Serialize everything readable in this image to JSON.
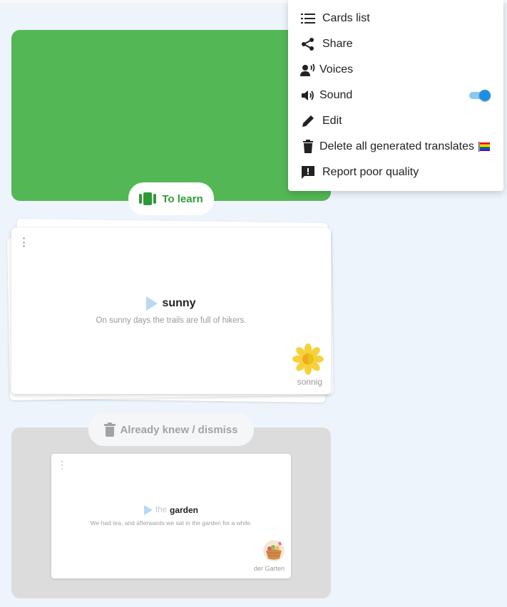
{
  "learn_panel": {
    "label": "To learn",
    "color": "#53b756"
  },
  "card": {
    "word": "sunny",
    "sentence": "On sunny days the trails are full of hikers.",
    "translation": "sonnig",
    "image": "sun-flower-icon"
  },
  "dismiss_panel": {
    "label": "Already knew / dismiss",
    "color": "#dcdcdc"
  },
  "dismissed_card": {
    "article": "the",
    "word": "garden",
    "sentence": "We had tea, and afterwards we sat in the garden for a while.",
    "translation": "der Garten",
    "image": "garden-basket-icon"
  },
  "menu": {
    "items": [
      {
        "label": "Cards list",
        "icon": "list-icon"
      },
      {
        "label": "Share",
        "icon": "share-icon"
      },
      {
        "label": "Voices",
        "icon": "voice-icon"
      },
      {
        "label": "Sound",
        "icon": "speaker-icon",
        "toggle_on": true
      },
      {
        "label": "Edit",
        "icon": "pencil-icon"
      },
      {
        "label": "Delete all generated translates",
        "icon": "trash-icon",
        "suffix": "rainbow-flag-icon"
      },
      {
        "label": "Report poor quality",
        "icon": "report-icon"
      }
    ]
  },
  "colors": {
    "accent": "#1f8fe4",
    "green_text": "#2e9a35",
    "background": "#eef4fc"
  }
}
